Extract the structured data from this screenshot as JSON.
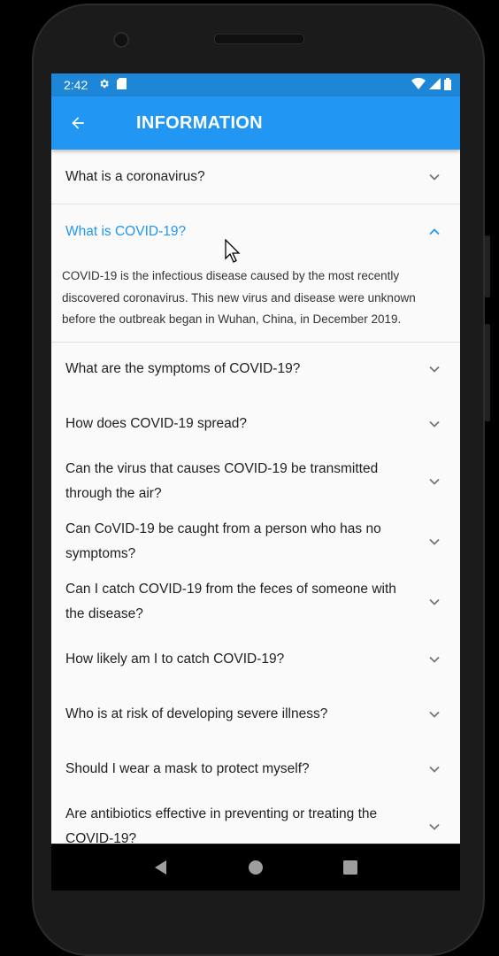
{
  "status_bar": {
    "time": "2:42",
    "icons": [
      "gear-icon",
      "sim-card-icon",
      "wifi-icon",
      "signal-icon",
      "battery-icon"
    ]
  },
  "app_bar": {
    "title": "INFORMATION",
    "back_icon": "arrow-left-icon"
  },
  "colors": {
    "primary": "#2196f3",
    "status_bar": "#1e86d6",
    "expanded_text": "#2196f3",
    "background": "#fafafa"
  },
  "faq": [
    {
      "question": "What is a coronavirus?",
      "expanded": false
    },
    {
      "question": "What is COVID-19?",
      "expanded": true,
      "answer": "COVID-19 is the infectious disease caused by the most recently discovered coronavirus. This new virus and disease were unknown before the outbreak began in Wuhan, China, in December 2019."
    },
    {
      "question": "What are the symptoms of COVID-19?",
      "expanded": false
    },
    {
      "question": "How does COVID-19 spread?",
      "expanded": false
    },
    {
      "question": "Can the virus that causes COVID-19 be transmitted through the air?",
      "expanded": false
    },
    {
      "question": "Can CoVID-19 be caught from a person who has no symptoms?",
      "expanded": false
    },
    {
      "question": "Can I catch COVID-19 from the feces of someone with the disease?",
      "expanded": false
    },
    {
      "question": "How likely am I to catch COVID-19?",
      "expanded": false
    },
    {
      "question": "Who is at risk of developing severe illness?",
      "expanded": false
    },
    {
      "question": "Should I wear a mask to protect myself?",
      "expanded": false
    },
    {
      "question": "Are antibiotics effective in preventing or treating the COVID-19?",
      "expanded": false
    }
  ],
  "nav_bar": {
    "icons": [
      "back-triangle-icon",
      "home-circle-icon",
      "recents-square-icon"
    ]
  }
}
